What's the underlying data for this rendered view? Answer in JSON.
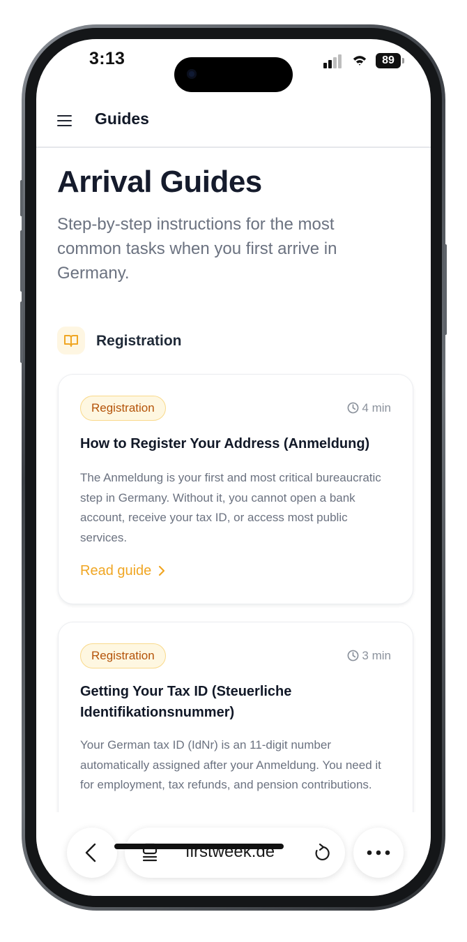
{
  "status_bar": {
    "time": "3:13",
    "battery": "89"
  },
  "header": {
    "title": "Guides"
  },
  "page": {
    "title": "Arrival Guides",
    "subtitle": "Step-by-step instructions for the most common tasks when you first arrive in Germany."
  },
  "section": {
    "title": "Registration",
    "icon": "book-open-icon",
    "accent_color": "#f0a623"
  },
  "guides": [
    {
      "tag": "Registration",
      "read_time": "4 min",
      "title": "How to Register Your Address (Anmeldung)",
      "description": "The Anmeldung is your first and most critical bureaucratic step in Germany. Without it, you cannot open a bank account, receive your tax ID, or access most public services.",
      "link_label": "Read guide"
    },
    {
      "tag": "Registration",
      "read_time": "3 min",
      "title": "Getting Your Tax ID (Steuerliche Identifikationsnummer)",
      "description": "Your German tax ID (IdNr) is an 11-digit number automatically assigned after your Anmeldung. You need it for employment, tax refunds, and pension contributions."
    }
  ],
  "browser": {
    "url": "firstweek.de"
  },
  "colors": {
    "tag_text": "#b45309",
    "tag_bg": "#fef7e1",
    "tag_border": "#f9d98a",
    "title_text": "#151b2c",
    "muted_text": "#6b7280"
  }
}
